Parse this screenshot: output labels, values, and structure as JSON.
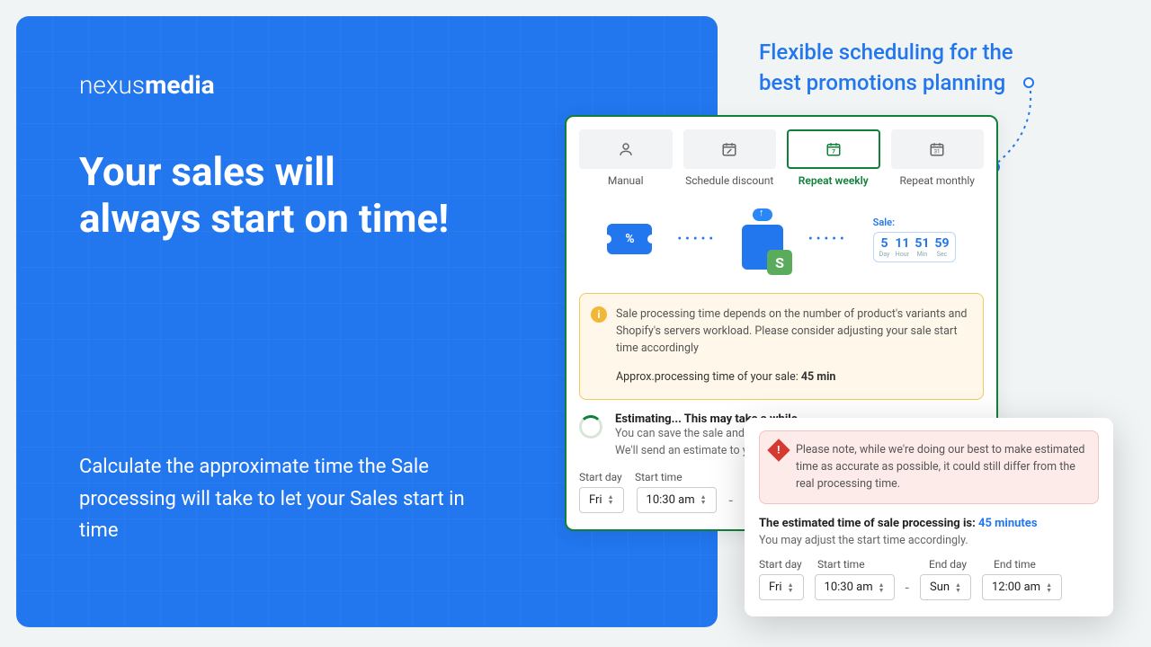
{
  "logo": {
    "thin": "nexus",
    "bold": "media"
  },
  "headline": "Your sales will always start on time!",
  "subline": "Calculate the approximate time the Sale processing will take to let your Sales start in time",
  "tagline": "Flexible scheduling for the best promotions planning",
  "tabs": {
    "manual": "Manual",
    "schedule": "Schedule discount",
    "weekly": "Repeat weekly",
    "monthly": "Repeat monthly"
  },
  "illus": {
    "coupon": "%",
    "sale_label": "Sale:",
    "countdown": [
      {
        "n": "5",
        "u": "Day"
      },
      {
        "n": "11",
        "u": "Hour"
      },
      {
        "n": "51",
        "u": "Min"
      },
      {
        "n": "59",
        "u": "Sec"
      }
    ]
  },
  "info": {
    "body": "Sale processing time depends on the number of product's variants and Shopify's servers workload. Please consider adjusting your sale start time accordingly",
    "approx_prefix": "Approx.processing time of your sale: ",
    "approx_val": "45 min"
  },
  "estimating": {
    "heading": "Estimating... This may take a while",
    "line1": "You can save the sale and come back to it later.",
    "line2": "We'll send an estimate to your email as well."
  },
  "left_sched": {
    "start_day_label": "Start day",
    "start_time_label": "Start time",
    "start_day": "Fri",
    "start_time": "10:30 am"
  },
  "overlay": {
    "warn": "Please note, while we're doing our best to make estimated time as accurate as possible, it could still differ from the real processing time.",
    "est_prefix": "The estimated time of sale processing is: ",
    "est_val": "45 minutes",
    "adjust": "You may adjust the start time accordingly.",
    "labels": {
      "sd": "Start day",
      "st": "Start time",
      "ed": "End day",
      "et": "End time"
    },
    "values": {
      "sd": "Fri",
      "st": "10:30 am",
      "ed": "Sun",
      "et": "12:00 am"
    }
  }
}
